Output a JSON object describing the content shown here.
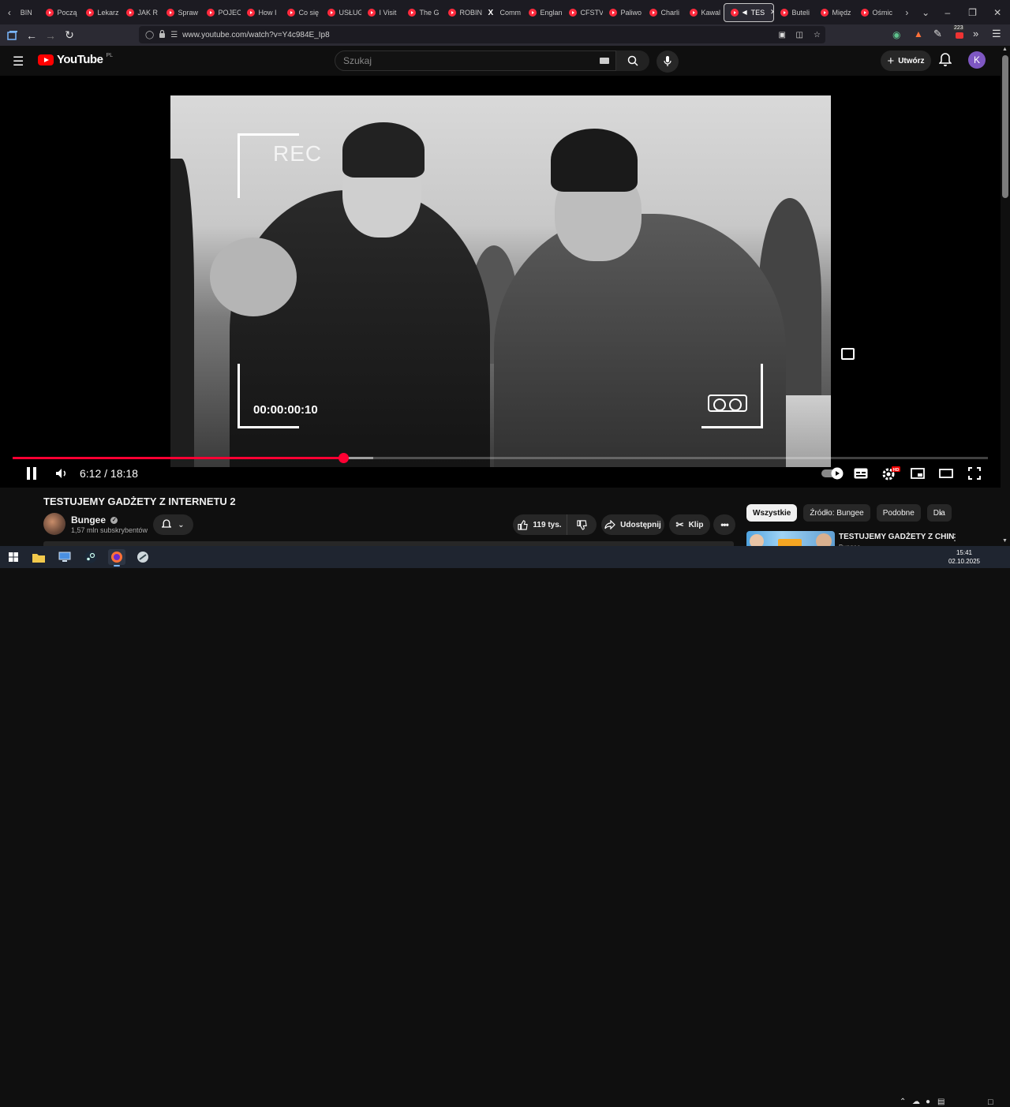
{
  "browser": {
    "tabs": [
      {
        "label": "Począ",
        "icon": "youtube-icon"
      },
      {
        "label": "Lekarz",
        "icon": "youtube-icon"
      },
      {
        "label": "JAK R",
        "icon": "youtube-icon"
      },
      {
        "label": "Spraw",
        "icon": "youtube-icon"
      },
      {
        "label": "POJEC",
        "icon": "youtube-icon"
      },
      {
        "label": "How I",
        "icon": "youtube-icon"
      },
      {
        "label": "Co się",
        "icon": "youtube-icon"
      },
      {
        "label": "USŁUG",
        "icon": "youtube-icon"
      },
      {
        "label": "I Visit",
        "icon": "youtube-icon"
      },
      {
        "label": "The G",
        "icon": "youtube-icon"
      },
      {
        "label": "ROBIN",
        "icon": "youtube-icon"
      },
      {
        "label": "Comm",
        "icon": "x-icon"
      },
      {
        "label": "Englan",
        "icon": "youtube-icon"
      },
      {
        "label": "CFSTV",
        "icon": "youtube-icon"
      },
      {
        "label": "Paliwo",
        "icon": "youtube-icon"
      },
      {
        "label": "Charli",
        "icon": "youtube-icon"
      },
      {
        "label": "Kawal",
        "icon": "youtube-icon"
      },
      {
        "label": "TES",
        "icon": "youtube-icon",
        "active": true
      },
      {
        "label": "Buteli",
        "icon": "youtube-icon"
      },
      {
        "label": "Międz",
        "icon": "youtube-icon"
      },
      {
        "label": "Ośmic",
        "icon": "youtube-icon"
      }
    ],
    "first_tab_fragment": "BIN",
    "url": "www.youtube.com/watch?v=Y4c984E_Ip8",
    "notification_count": "223"
  },
  "yt": {
    "logo_text": "YouTube",
    "country_code": "PL",
    "search_placeholder": "Szukaj",
    "create_label": "Utwórz",
    "avatar_letter": "K",
    "avatar_color": "#7e57c2"
  },
  "video": {
    "overlay_rec": "REC",
    "overlay_timecode": "00:00:00:10",
    "current_time": "6:12",
    "duration": "18:18",
    "time_display": "6:12 / 18:18",
    "progress_fraction": 0.339,
    "buffered_fraction": 0.37,
    "accent": "#ff0033"
  },
  "details": {
    "title": "TESTUJEMY GADŻETY Z INTERNETU 2",
    "channel": "Bungee",
    "subscribers": "1,57 mln subskrybentów",
    "likes": "119 tys.",
    "share_label": "Udostępnij",
    "clip_label": "Klip"
  },
  "sidebar": {
    "chips": [
      {
        "label": "Wszystkie",
        "active": true
      },
      {
        "label": "Źródło: Bungee",
        "active": false
      },
      {
        "label": "Podobne",
        "active": false
      },
      {
        "label": "Dla",
        "active": false
      }
    ],
    "recommendation": {
      "title": "TESTUJEMY GADŻETY Z CHIN",
      "channel": "Bungee"
    }
  },
  "taskbar": {
    "time": "15:41",
    "date": "02.10.2025"
  }
}
